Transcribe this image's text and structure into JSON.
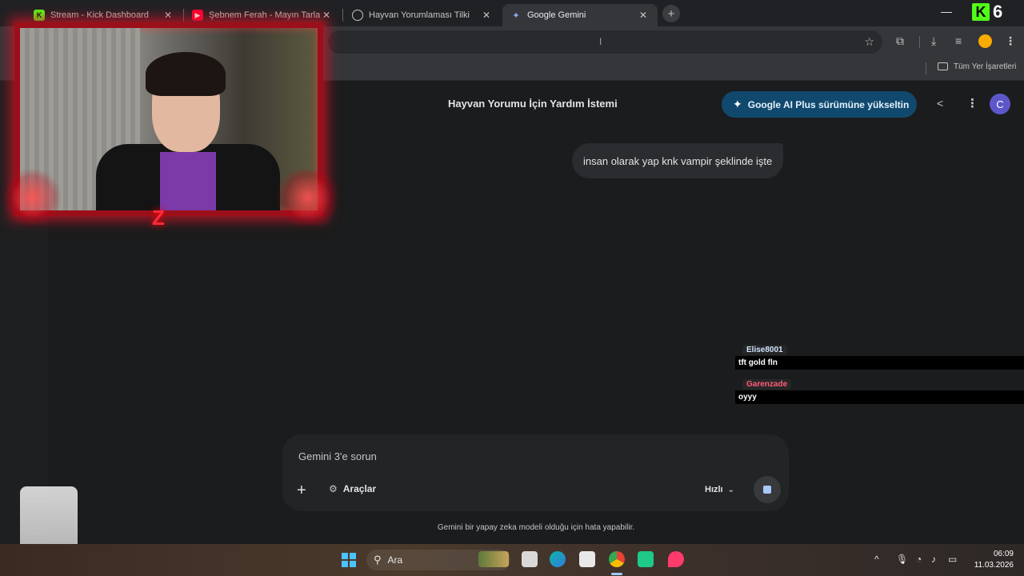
{
  "browser": {
    "tabs": [
      {
        "title": "Stream - Kick Dashboard",
        "favicon": "kick-icon",
        "active": false
      },
      {
        "title": "Şebnem Ferah - Mayın Tarlası",
        "favicon": "youtube-icon",
        "active": false
      },
      {
        "title": "Hayvan Yorumlaması Tilki",
        "favicon": "chatgpt-icon",
        "active": false
      },
      {
        "title": "Google Gemini",
        "favicon": "gemini-icon",
        "active": true
      }
    ],
    "close_glyph": "✕",
    "new_tab_glyph": "+",
    "minimize_glyph": "—",
    "omnibox_value": "",
    "bookmarks_label": "Tüm Yer İşaretleri"
  },
  "stream_overlay": {
    "kick_viewer_count": "6",
    "kick_logo": "K",
    "chat": [
      {
        "user": "Elise8001",
        "user_color": "#cfe3ff",
        "text": "tft gold fln"
      },
      {
        "user": "Garenzade",
        "user_color": "#ff5c7a",
        "text": "oyyy"
      }
    ]
  },
  "gemini": {
    "chat_title": "Hayvan Yorumu İçin Yardım İstemi",
    "upgrade_label": "Google AI Plus sürümüne yükseltin",
    "account_initial": "C",
    "user_message": "insan olarak yap knk vampir şeklinde işte",
    "composer_placeholder": "Gemini 3'e sorun",
    "add_glyph": "+",
    "tools_label": "Araçlar",
    "model_label": "Hızlı",
    "disclaimer": "Gemini bir yapay zeka modeli olduğu için hata yapabilir."
  },
  "taskbar": {
    "search_placeholder": "Ara",
    "time": "06:09",
    "date": "11.03.2026"
  },
  "colors": {
    "accent_blue": "#11496e",
    "stop_square": "#a8c7fa",
    "webcam_frame": "#9b0f1a",
    "kick_green": "#53fc18"
  }
}
